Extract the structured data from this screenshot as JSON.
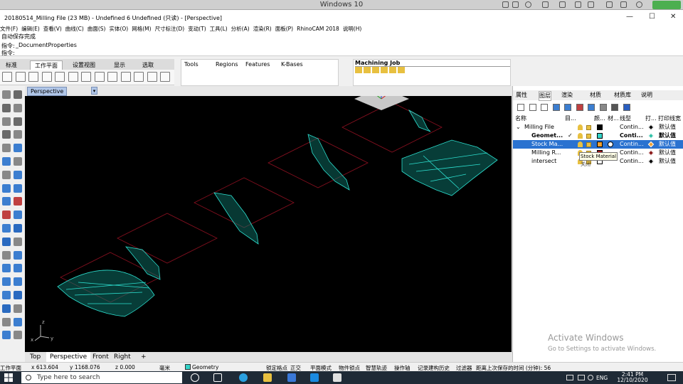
{
  "vm": {
    "title": "Windows 10"
  },
  "window": {
    "title": "20180514_Milling File (23 MB) - Undefined 6 Undefined (只读) - [Perspective]",
    "min": "—",
    "max": "☐",
    "close": "✕"
  },
  "menu": [
    "文件(F)",
    "编辑(E)",
    "查看(V)",
    "曲线(C)",
    "曲面(S)",
    "实体(O)",
    "网格(M)",
    "尺寸标注(D)",
    "变动(T)",
    "工具(L)",
    "分析(A)",
    "渲染(R)",
    "面板(P)",
    "RhinoCAM 2018",
    "说明(H)"
  ],
  "command": {
    "line1": "自动保存完成",
    "line2_label": "指令:",
    "line2_value": "_DocumentProperties",
    "line3_label": "指令:"
  },
  "toolbar_tabs": [
    "标准",
    "工作平面",
    "设置视图",
    "显示",
    "选取"
  ],
  "panel2_tabs": [
    "Tools",
    "Regions",
    "Features",
    "K-Bases"
  ],
  "machining_job": {
    "title": "Machining Job"
  },
  "viewport": {
    "label": "Perspective",
    "drop": "▾",
    "axis_x": "x",
    "axis_y": "y",
    "axis_z": "z"
  },
  "view_tabs": [
    "Top",
    "Perspective",
    "Front",
    "Right",
    "+"
  ],
  "right_tabs": [
    "属性",
    "图层",
    "渲染",
    "材质",
    "材质库",
    "说明"
  ],
  "layer_header": {
    "name": "名称",
    "current": "目...",
    "color": "颜...",
    "material": "材...",
    "linetype": "线型",
    "print": "打...",
    "print_width": "打印线宽"
  },
  "layers": [
    {
      "name": "Milling File",
      "expander": "⌄",
      "current": "",
      "color": "#000000",
      "linetype": "Contin...",
      "print_color": "#000000",
      "print_width": "默认值",
      "bold": false,
      "selected": false
    },
    {
      "name": "Geomet...",
      "expander": "",
      "current": "✓",
      "color": "#33d3c8",
      "linetype": "Conti...",
      "print_color": "#33c2a8",
      "print_width": "默认值",
      "bold": true,
      "selected": false
    },
    {
      "name": "Stock Ma...",
      "expander": "",
      "current": "",
      "color": "#f0a030",
      "linetype": "Contin...",
      "print_color": "#f0a030",
      "print_width": "默认值",
      "bold": false,
      "selected": true
    },
    {
      "name": "Milling R...",
      "expander": "",
      "current": "",
      "color": "#a01818",
      "linetype": "Contin...",
      "print_color": "#8b1a1a",
      "print_width": "默认值",
      "bold": false,
      "selected": false
    },
    {
      "name": "intersect",
      "expander": "",
      "current": "",
      "color": "#ffffff",
      "linetype": "Contin...",
      "print_color": "#000000",
      "print_width": "默认值",
      "bold": false,
      "selected": false
    }
  ],
  "tooltip": {
    "text": "Stock Material",
    "sub": "关闭"
  },
  "activate": {
    "line1": "Activate Windows",
    "line2": "Go to Settings to activate Windows."
  },
  "status": {
    "cplane": "工作平面",
    "x": "x 613.604",
    "y": "y 1168.076",
    "z": "z 0.000",
    "units": "毫米",
    "layer": "Geometry",
    "items": [
      "锁定格点",
      "正交",
      "平面模式",
      "物件锁点",
      "智慧轨迹",
      "操作轴",
      "记录建构历史",
      "过滤器",
      "距离上次保存的时间 (分钟): 56"
    ]
  },
  "taskbar": {
    "search": "Type here to search",
    "lang": "ENG",
    "time": "2:41 PM",
    "date": "12/10/2020"
  },
  "colors": {
    "mesh": "#2de0d0",
    "stock": "#8a1020",
    "selected": "#2a72d0"
  }
}
